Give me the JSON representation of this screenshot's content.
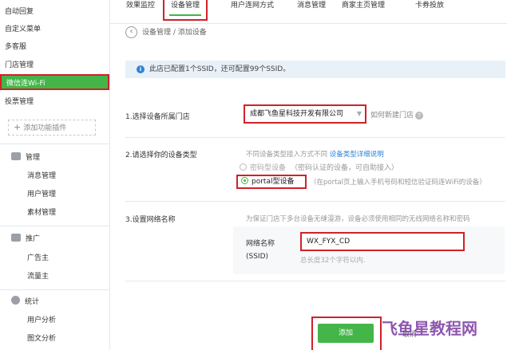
{
  "sidebar": {
    "top_items": [
      {
        "label": "自动回复"
      },
      {
        "label": "自定义菜单"
      },
      {
        "label": "多客服"
      },
      {
        "label": "门店管理"
      },
      {
        "label": "微信连Wi-Fi"
      },
      {
        "label": "投票管理"
      }
    ],
    "add_plugin_label": "添加功能插件",
    "groups": [
      {
        "title": "管理",
        "items": [
          "消息管理",
          "用户管理",
          "素材管理"
        ]
      },
      {
        "title": "推广",
        "items": [
          "广告主",
          "流量主"
        ]
      },
      {
        "title": "统计",
        "items": [
          "用户分析",
          "图文分析"
        ]
      }
    ]
  },
  "tabs": [
    "效果监控",
    "设备管理",
    "用户连网方式",
    "消息管理",
    "商家主页管理",
    "卡券投放"
  ],
  "breadcrumb": "设备管理 / 添加设备",
  "notice": "此店已配置1个SSID，还可配置99个SSID。",
  "form": {
    "step1_label": "1.选择设备所属门店",
    "store_value": "成都飞鱼星科技开发有限公司",
    "help_link": "如何新建门店",
    "step2_label": "2.请选择你的设备类型",
    "step2_hint": "不同设备类型接入方式不同",
    "step2_link": "设备类型详细说明",
    "option_password": "密码型设备",
    "option_password_note": "（密码认证的设备，可自助接入）",
    "option_portal": "portal型设备",
    "option_portal_note": "（在portal页上输入手机号码和短信验证码连WiFi的设备）",
    "step3_label": "3.设置网络名称",
    "step3_hint": "为保证门店下多台设备无缝漫游，设备必须使用相同的无线网络名称和密码",
    "ssid_label_1": "网络名称",
    "ssid_label_2": "(SSID)",
    "ssid_value": "WX_FYX_CD",
    "ssid_hint": "总长度32个字符以内."
  },
  "buttons": {
    "add": "添加",
    "cancel": "取消"
  },
  "watermark": "飞鱼星教程网",
  "colors": {
    "accent": "#44b549",
    "highlight": "#d0212a",
    "link": "#2e84d6",
    "watermark": "#7b3aa3"
  }
}
